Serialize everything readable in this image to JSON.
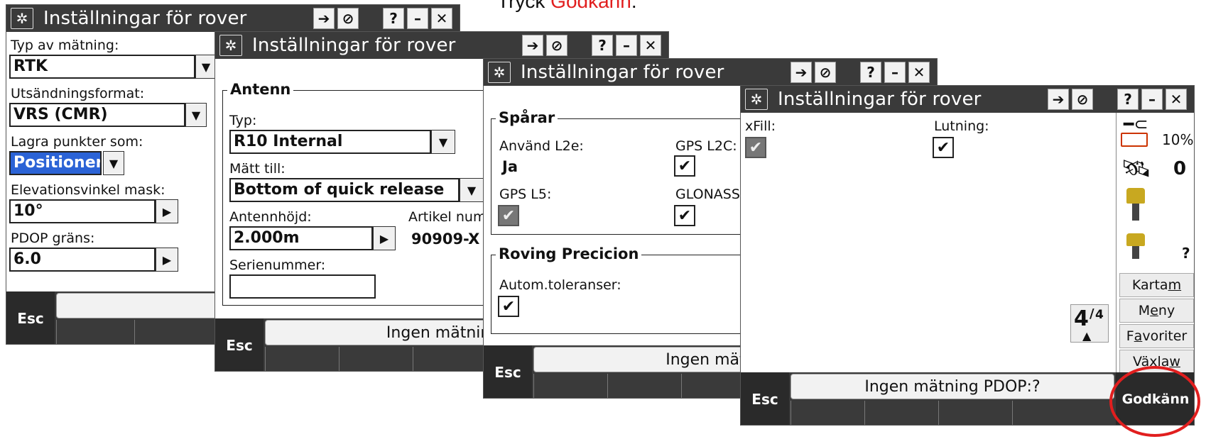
{
  "instruction": {
    "prefix": "Tryck ",
    "highlight": "Godkänn",
    "suffix": "."
  },
  "window_title": "Inställningar för rover",
  "w1": {
    "type_label": "Typ av mätning:",
    "type_value": "RTK",
    "format_label": "Utsändningsformat:",
    "format_value": "VRS (CMR)",
    "store_label": "Lagra punkter som:",
    "store_value": "Positioner",
    "elev_label": "Elevationsvinkel mask:",
    "elev_value": "10°",
    "pdop_label": "PDOP gräns:",
    "pdop_value": "6.0",
    "esc": "Esc"
  },
  "w2": {
    "group_antenna": "Antenn",
    "type_label": "Typ:",
    "type_value": "R10 Internal",
    "measured_label": "Mätt till:",
    "measured_value": "Bottom of quick release",
    "height_label": "Antennhöjd:",
    "height_value": "2.000m",
    "article_label": "Artikel num",
    "article_value": "90909-X",
    "serial_label": "Serienummer:",
    "serial_value": "",
    "status": "Ingen mätning  PDOP",
    "esc": "Esc"
  },
  "w3": {
    "group_tracking": "Spårar",
    "l2e_label": "Använd L2e:",
    "l2e_value": "Ja",
    "l2c_label": "GPS L2C:",
    "l5_label": "GPS L5:",
    "glonass_label": "GLONASS",
    "group_precision": "Roving Precicion",
    "autotol_label": "Autom.toleranser:",
    "status": "Ingen mätning  PD",
    "esc": "Esc"
  },
  "w4": {
    "xfill_label": "xFill:",
    "tilt_label": "Lutning:",
    "status": "Ingen mätning  PDOP:?",
    "esc": "Esc",
    "accept": "Godkänn",
    "battery_percent": "10%",
    "satellites": "0",
    "rover_status": "?",
    "page_num": "4",
    "page_total": "4",
    "side_buttons": [
      {
        "text": "Karta ",
        "key": "m"
      },
      {
        "pre": "M",
        "key": "e",
        "post": "ny"
      },
      {
        "pre": "F",
        "key": "a",
        "post": "voriter"
      },
      {
        "text": "Växla ",
        "key": "w"
      }
    ],
    "highlight_color": "#e11e1e",
    "battery_color": "#cc3300"
  }
}
